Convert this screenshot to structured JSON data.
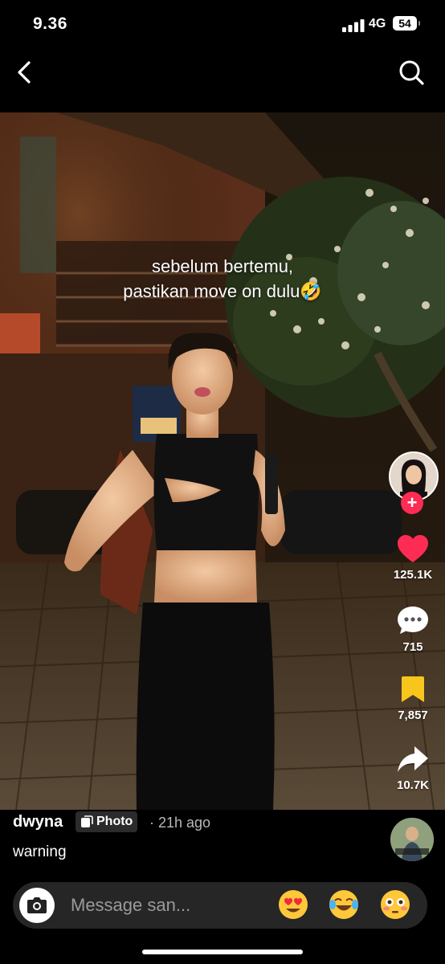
{
  "status": {
    "time": "9.36",
    "network": "4G",
    "battery": "54"
  },
  "nav": {
    "back_icon": "chevron-left-icon",
    "search_icon": "search-icon"
  },
  "post": {
    "caption_lines": [
      "sebelum bertemu,",
      "pastikan move on dulu🤣"
    ],
    "username": "dwyna",
    "type_label": "Photo",
    "time_ago": "· 21h ago",
    "description": "warning"
  },
  "actions": {
    "likes": "125.1K",
    "comments": "715",
    "saves": "7,857",
    "shares": "10.7K"
  },
  "composer": {
    "placeholder": "Message san...",
    "quick_emojis": [
      "heart-eyes-emoji",
      "tears-of-joy-emoji",
      "flushed-face-emoji"
    ]
  },
  "colors": {
    "like": "#fe2c55",
    "bookmark": "#f7c51b",
    "background": "#000000"
  }
}
